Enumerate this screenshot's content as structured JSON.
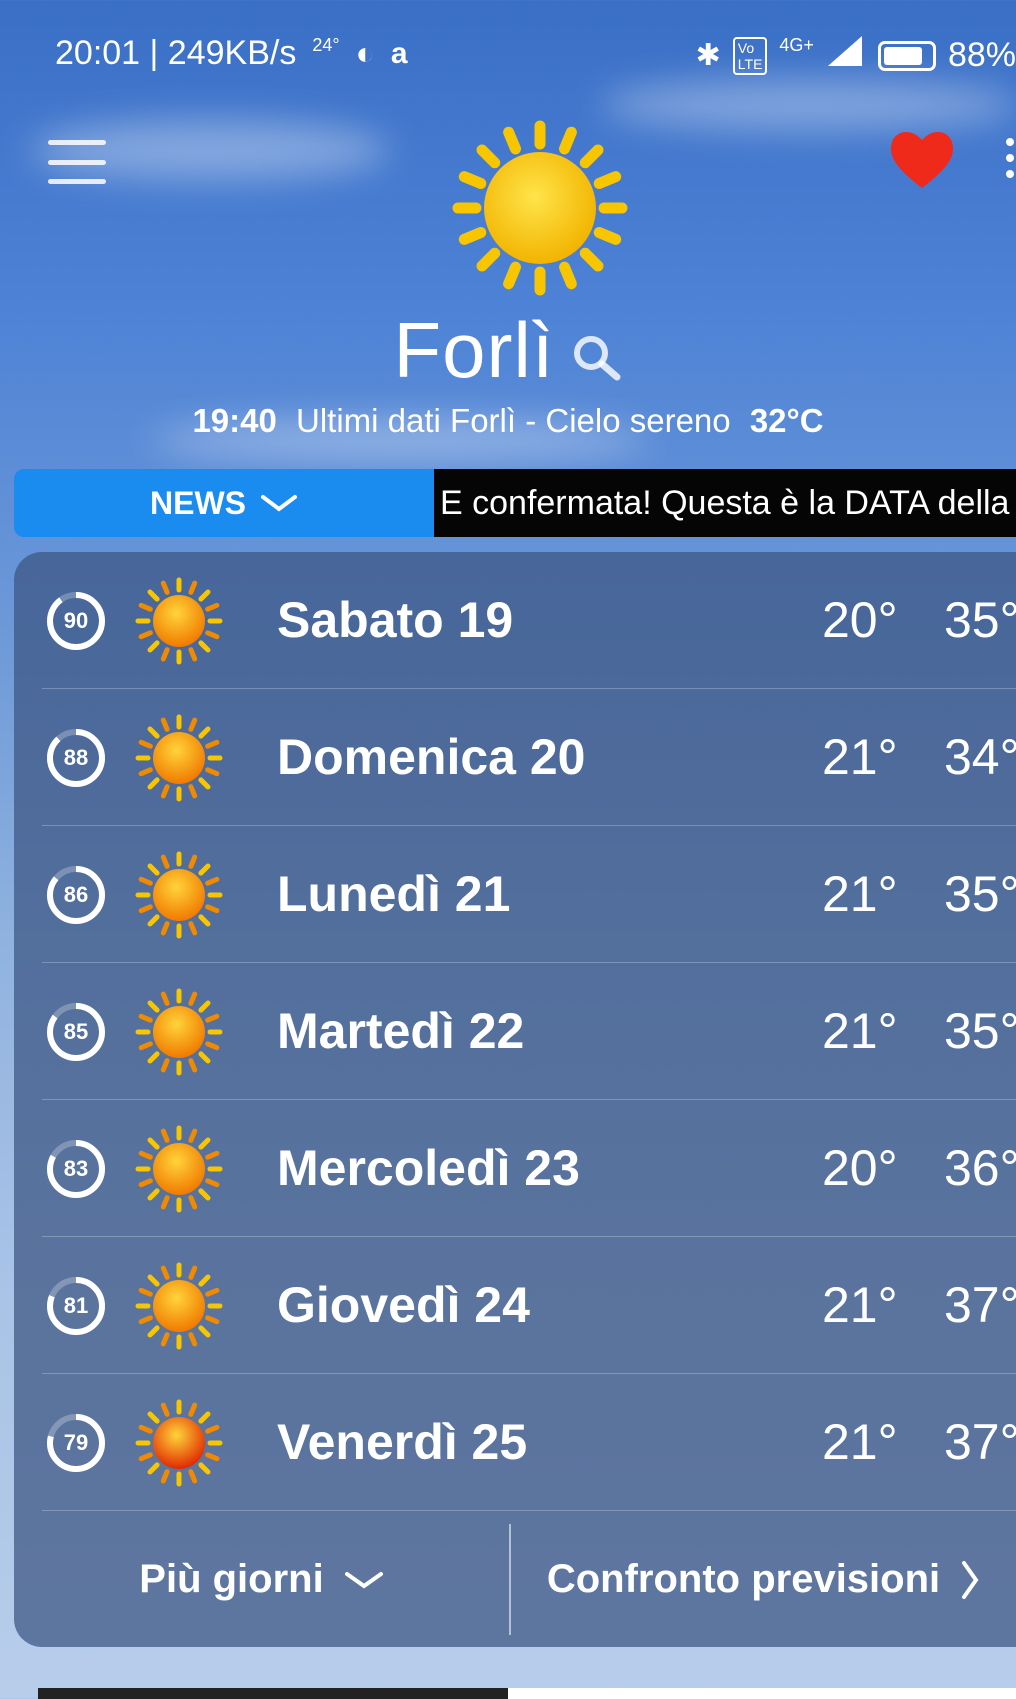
{
  "status_bar": {
    "time_speed": "20:01 | 249KB/s",
    "temp_small": "24°",
    "network": "4G+",
    "battery": "88%"
  },
  "header": {
    "city": "Forlì",
    "update_time": "19:40",
    "update_text": "Ultimi dati Forlì - Cielo sereno",
    "current_temp": "32°C",
    "menu_icon": "hamburger-menu-icon",
    "favorite_icon": "heart-icon",
    "search_icon": "search-icon"
  },
  "news": {
    "label": "NEWS",
    "ticker": "E confermata! Questa è la DATA della"
  },
  "forecast": [
    {
      "score": "90",
      "day": "Sabato 19",
      "min": "20°",
      "max": "35°",
      "level": 0.9
    },
    {
      "score": "88",
      "day": "Domenica 20",
      "min": "21°",
      "max": "34°",
      "level": 0.88
    },
    {
      "score": "86",
      "day": "Lunedì 21",
      "min": "21°",
      "max": "35°",
      "level": 0.86
    },
    {
      "score": "85",
      "day": "Martedì 22",
      "min": "21°",
      "max": "35°",
      "level": 0.85
    },
    {
      "score": "83",
      "day": "Mercoledì 23",
      "min": "20°",
      "max": "36°",
      "level": 0.83
    },
    {
      "score": "81",
      "day": "Giovedì 24",
      "min": "21°",
      "max": "37°",
      "level": 0.81
    },
    {
      "score": "79",
      "day": "Venerdì 25",
      "min": "21°",
      "max": "37°",
      "level": 0.79
    }
  ],
  "footer": {
    "more_days": "Più giorni",
    "compare": "Confronto previsioni"
  },
  "colors": {
    "news_blue": "#1a8cf0",
    "heart_red": "#f02a1a",
    "sun_yellow": "#f7c600"
  }
}
